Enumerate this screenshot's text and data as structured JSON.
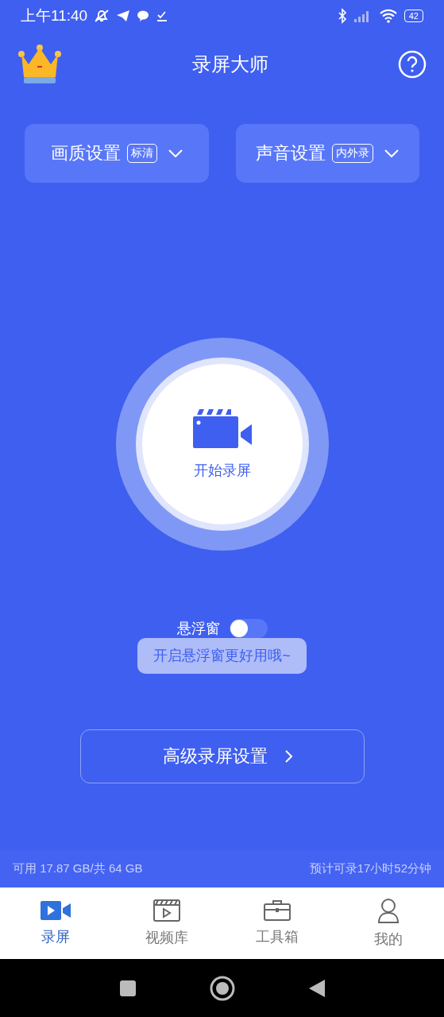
{
  "status_bar": {
    "time": "上午11:40",
    "battery": "42"
  },
  "header": {
    "title": "录屏大师"
  },
  "settings": [
    {
      "label": "画质设置",
      "tag": "标清"
    },
    {
      "label": "声音设置",
      "tag": "内外录"
    }
  ],
  "record_button": {
    "label": "开始录屏"
  },
  "floating_window": {
    "label": "悬浮窗",
    "on": false,
    "hint": "开启悬浮窗更好用哦~"
  },
  "advanced_button": {
    "label": "高级录屏设置"
  },
  "storage": {
    "available": "可用 17.87 GB/共 64 GB",
    "estimate": "预计可录17小时52分钟"
  },
  "tabs": [
    {
      "kind": "record",
      "label": "录屏",
      "selected": true
    },
    {
      "kind": "library",
      "label": "视频库",
      "selected": false
    },
    {
      "kind": "toolbox",
      "label": "工具箱",
      "selected": false
    },
    {
      "kind": "profile",
      "label": "我的",
      "selected": false
    }
  ]
}
